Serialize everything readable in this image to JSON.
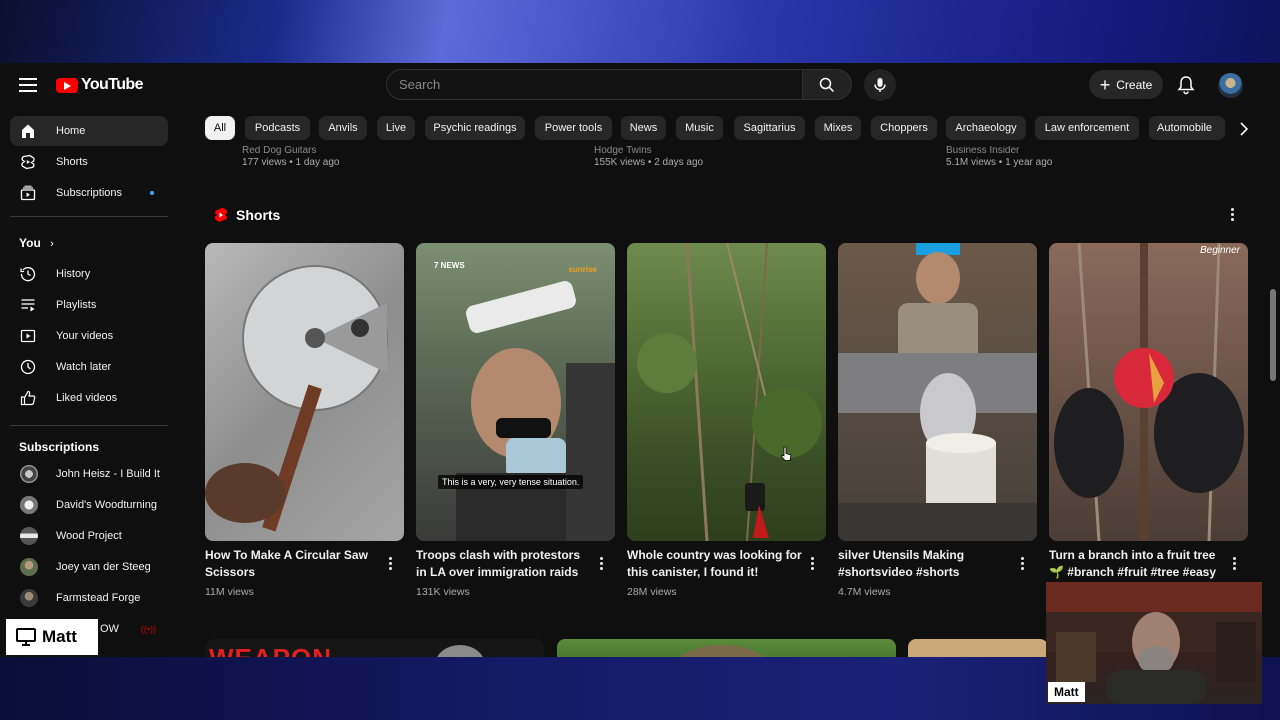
{
  "topbar": {
    "logo_text": "YouTube",
    "search_placeholder": "Search",
    "create_label": "Create"
  },
  "sidebar": {
    "main_items": [
      {
        "label": "Home",
        "icon": "home-icon",
        "active": true
      },
      {
        "label": "Shorts",
        "icon": "shorts-icon"
      },
      {
        "label": "Subscriptions",
        "icon": "subscriptions-icon"
      }
    ],
    "you_heading": "You",
    "you_items": [
      {
        "label": "History",
        "icon": "history-icon"
      },
      {
        "label": "Playlists",
        "icon": "playlists-icon"
      },
      {
        "label": "Your videos",
        "icon": "your-videos-icon"
      },
      {
        "label": "Watch later",
        "icon": "watch-later-icon"
      },
      {
        "label": "Liked videos",
        "icon": "thumbs-up-icon"
      }
    ],
    "subscriptions_heading": "Subscriptions",
    "subscriptions": [
      {
        "name": "John Heisz - I Build It"
      },
      {
        "name": "David's Woodturning"
      },
      {
        "name": "Wood Project"
      },
      {
        "name": "Joey van der Steeg"
      },
      {
        "name": "Farmstead Forge"
      },
      {
        "name": "OW"
      }
    ]
  },
  "chips": [
    "All",
    "Podcasts",
    "Anvils",
    "Live",
    "Psychic readings",
    "Power tools",
    "News",
    "Music",
    "Sagittarius",
    "Mixes",
    "Choppers",
    "Archaeology",
    "Law enforcement",
    "Automobile"
  ],
  "previous_row": [
    {
      "channel": "Red Dog Guitars",
      "meta": "177 views • 1 day ago"
    },
    {
      "channel": "Hodge Twins",
      "meta": "155K views • 2 days ago"
    },
    {
      "channel": "Business Insider",
      "meta": "5.1M views • 1 year ago"
    }
  ],
  "shorts": {
    "heading": "Shorts",
    "items": [
      {
        "title": "How To Make A Circular Saw Scissors",
        "views": "11M views"
      },
      {
        "title": "Troops clash with protestors in LA over immigration raids",
        "views": "131K views",
        "caption": "This is a very, very tense situation.",
        "badge_left": "7 NEWS",
        "badge_right": "sunrise"
      },
      {
        "title": "Whole country was looking for this canister, I found it!",
        "views": "28M views"
      },
      {
        "title": "silver Utensils Making #shortsvideo #shorts",
        "views": "4.7M views"
      },
      {
        "title": "Turn a branch into a fruit tree 🌱 #branch #fruit #tree #easy",
        "views": "",
        "watermark": "Beginner"
      }
    ]
  },
  "bottom_row": {
    "thumb1_text": "WEAPON"
  },
  "overlays": {
    "presenter_label": "Matt",
    "webcam_name": "Matt"
  },
  "colors": {
    "youtube_red": "#ff0000",
    "background": "#0f0f0f",
    "chip_bg": "#272727",
    "subscription_dot": "#3ea6ff"
  }
}
